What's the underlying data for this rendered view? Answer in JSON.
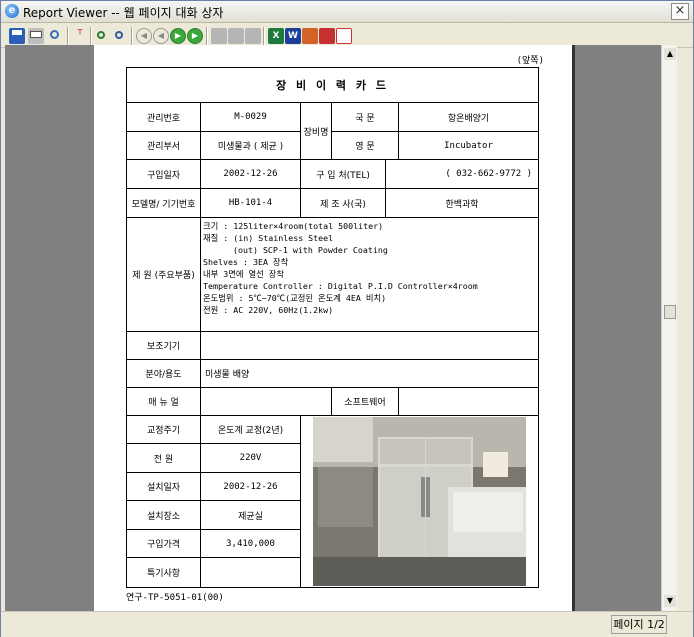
{
  "window": {
    "title": "Report Viewer -- 웹 페이지 대화 상자",
    "close_label": "×"
  },
  "toolbar": {
    "icons": [
      "save-icon",
      "print-icon",
      "search-icon",
      "filter-icon",
      "find-icon",
      "find-next-icon",
      "first-page-icon",
      "prev-page-icon",
      "next-page-icon",
      "last-page-icon",
      "export-icon",
      "import-icon",
      "refresh-icon",
      "excel-icon",
      "word-icon",
      "ppt-icon",
      "mail-icon",
      "pdf-icon"
    ]
  },
  "report": {
    "cover_label": "(앞쪽)",
    "title": "장 비 이 력 카 드",
    "rows": {
      "mgmt_no_label": "관리번호",
      "mgmt_no": "M-0029",
      "equip_name_label": "장비명",
      "korean_label": "국 문",
      "korean_name": "항온배양기",
      "dept_label": "관리부서",
      "dept": "미생물과 ( 제균 )",
      "english_label": "영 문",
      "english_name": "Incubator",
      "purchase_date_label": "구입일자",
      "purchase_date": "2002-12-26",
      "vendor_label": "구 입 처(TEL)",
      "vendor_tel": "( 032-662-9772 )",
      "model_label": "모델명/ 기기번호",
      "model": "HB-101-4",
      "maker_label": "제 조 사(국)",
      "maker": "한백과학",
      "spec_label": "제 원 (주요부품)",
      "spec_lines": [
        "크기 : 125liter×4room(total 500liter)",
        "재질 : (in) Stainless Steel",
        "      (out) SCP-1 with Powder Coating",
        "Shelves : 3EA 장착",
        "내부 3면에 열선 장착",
        "Temperature Controller : Digital P.I.D Controller×4room",
        "온도범위 : 5℃~70℃(교정된 온도계 4EA 비치)",
        "전원 : AC 220V, 60Hz(1.2kw)"
      ],
      "aux_label": "보조기기",
      "aux": "",
      "field_label": "분야/용도",
      "field": "미생물 배양",
      "manual_label": "매 뉴 얼",
      "manual": "",
      "software_label": "소프트웨어",
      "software": "",
      "calib_label": "교정주기",
      "calib": "온도계 교정(2년)",
      "power_label": "전 원",
      "power": "220V",
      "install_date_label": "설치일자",
      "install_date": "2002-12-26",
      "location_label": "설치장소",
      "location": "제균실",
      "price_label": "구입가격",
      "price": "3,410,000",
      "notes_label": "특기사항",
      "notes": ""
    },
    "footer": "연구-TP-5051-01(00)"
  },
  "status": {
    "page_indicator": "페이지 1/2"
  }
}
